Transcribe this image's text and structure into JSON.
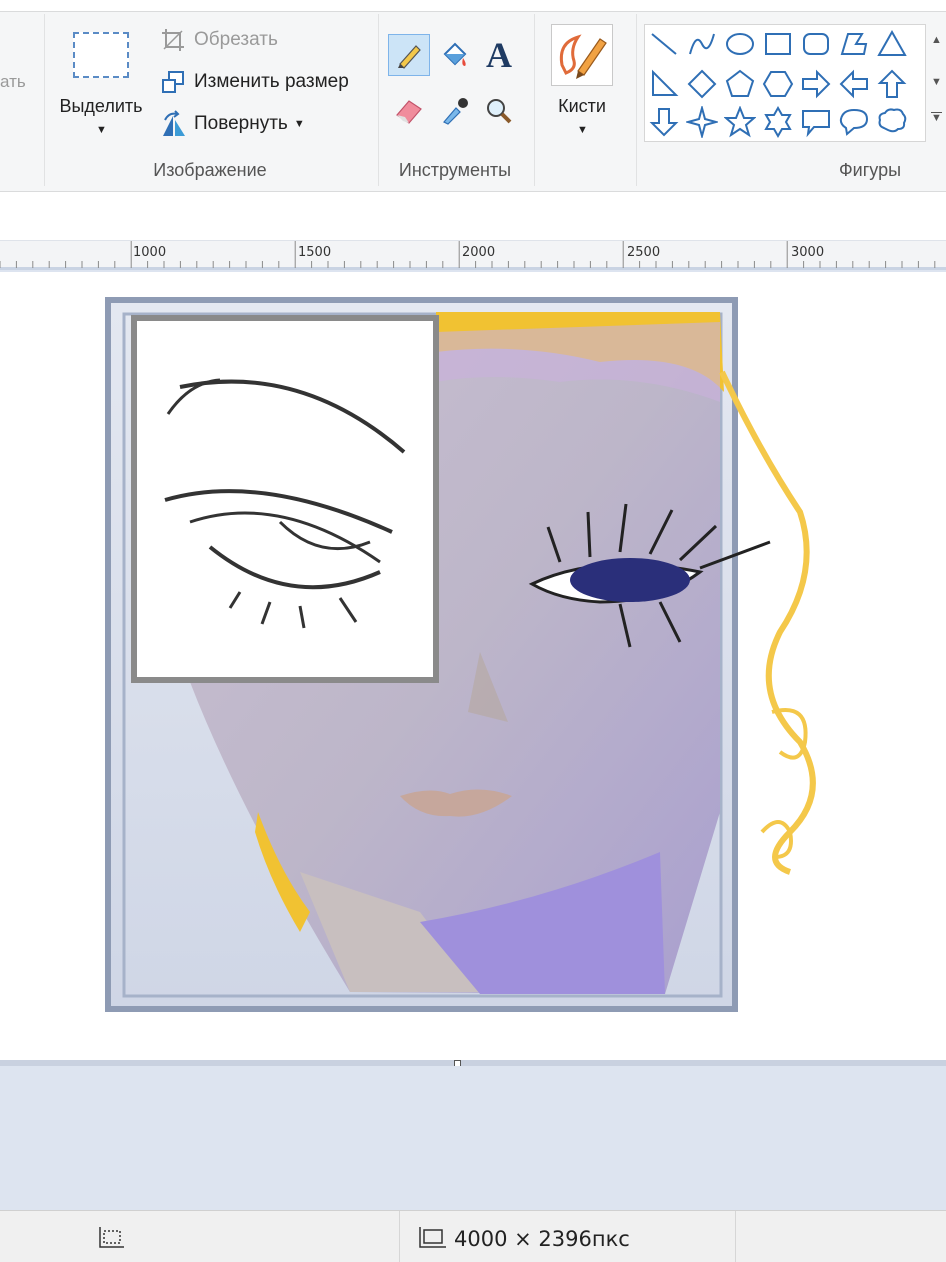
{
  "ribbon": {
    "clipboard_partial_label": "ать",
    "select": {
      "label": "Выделить"
    },
    "image_group": {
      "crop": "Обрезать",
      "resize": "Изменить размер",
      "rotate": "Повернуть",
      "label": "Изображение"
    },
    "tools_group": {
      "label": "Инструменты"
    },
    "brushes": {
      "label": "Кисти"
    },
    "shapes_group": {
      "label": "Фигуры"
    }
  },
  "ruler": {
    "ticks": [
      "1000",
      "1500",
      "2000",
      "2500",
      "3000"
    ]
  },
  "statusbar": {
    "image_size": "4000 × 2396пкс"
  },
  "colors": {
    "selection_blue": "#5a8bc5",
    "active_tool_bg": "#cce4f7",
    "workspace": "#dde4f0"
  }
}
